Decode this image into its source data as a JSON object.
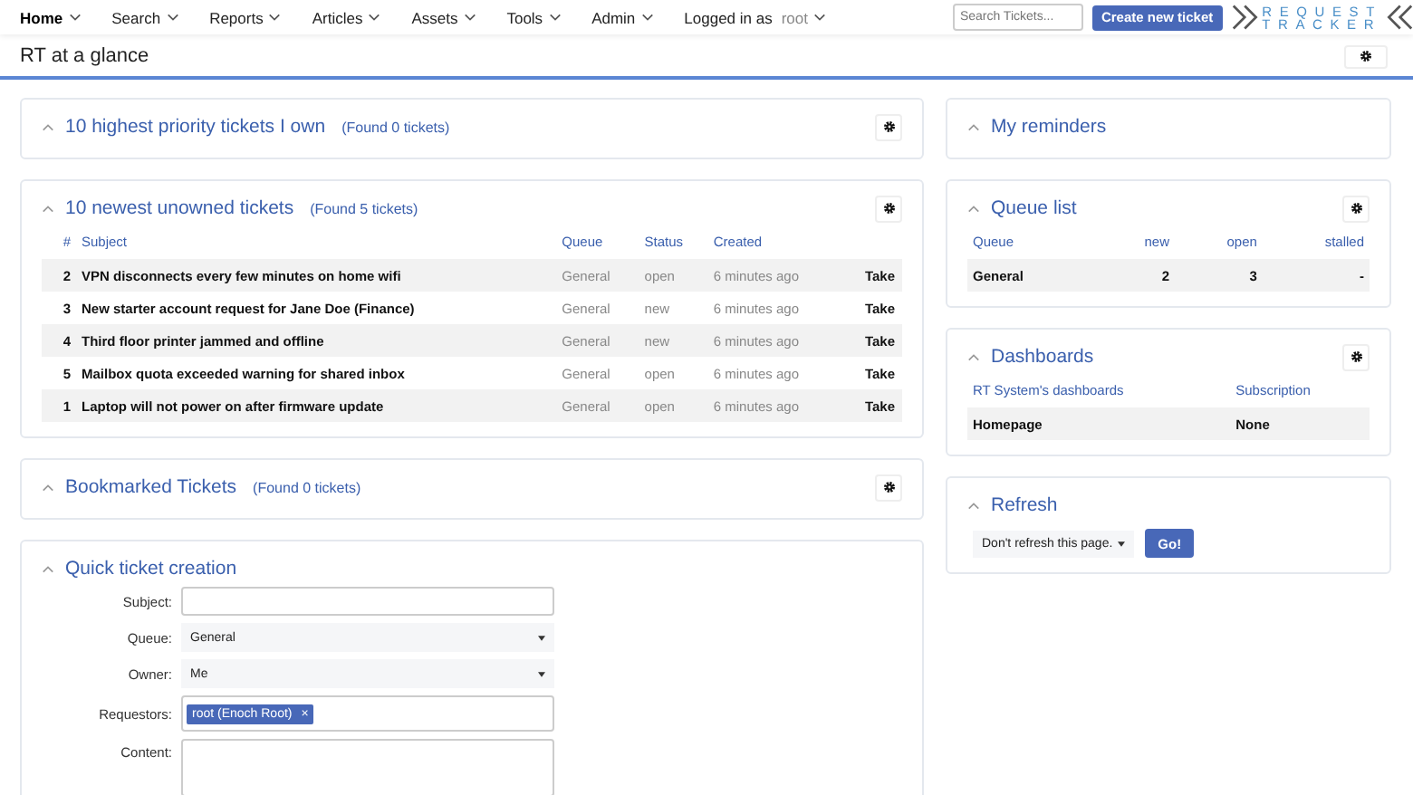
{
  "menu": [
    {
      "label": "Home",
      "selected": true
    },
    {
      "label": "Search",
      "selected": false
    },
    {
      "label": "Reports",
      "selected": false
    },
    {
      "label": "Articles",
      "selected": false
    },
    {
      "label": "Assets",
      "selected": false
    },
    {
      "label": "Tools",
      "selected": false
    },
    {
      "label": "Admin",
      "selected": false
    }
  ],
  "user_menu": {
    "label": "Logged in as",
    "user": "root"
  },
  "search": {
    "placeholder": "Search Tickets..."
  },
  "create_button": "Create new ticket",
  "logo": {
    "line_1": "REQUEST",
    "line_2": "TRACKER"
  },
  "page_title": "RT at a glance",
  "left_panels": [
    {
      "kind": "empty",
      "title": "10 highest priority tickets I own",
      "count": "(Found 0 tickets)",
      "settings": true
    },
    {
      "kind": "tickets",
      "title": "10 newest unowned tickets",
      "count": "(Found 5 tickets)",
      "settings": true,
      "columns": [
        "#",
        "Subject",
        "Queue",
        "Status",
        "Created"
      ],
      "rows": [
        {
          "id": "2",
          "subject": "VPN disconnects every few minutes on home wifi",
          "queue": "General",
          "status": "open",
          "created": "6 minutes ago",
          "action": "Take"
        },
        {
          "id": "3",
          "subject": "New starter account request for Jane Doe (Finance)",
          "queue": "General",
          "status": "new",
          "created": "6 minutes ago",
          "action": "Take"
        },
        {
          "id": "4",
          "subject": "Third floor printer jammed and offline",
          "queue": "General",
          "status": "new",
          "created": "6 minutes ago",
          "action": "Take"
        },
        {
          "id": "5",
          "subject": "Mailbox quota exceeded warning for shared inbox",
          "queue": "General",
          "status": "open",
          "created": "6 minutes ago",
          "action": "Take"
        },
        {
          "id": "1",
          "subject": "Laptop will not power on after firmware update",
          "queue": "General",
          "status": "open",
          "created": "6 minutes ago",
          "action": "Take"
        }
      ]
    },
    {
      "kind": "empty",
      "title": "Bookmarked Tickets",
      "count": "(Found 0 tickets)",
      "settings": true
    },
    {
      "kind": "form",
      "title": "Quick ticket creation",
      "settings": false,
      "fields": [
        {
          "kind": "text",
          "label": "Subject:"
        },
        {
          "kind": "select",
          "label": "Queue:",
          "value": "General"
        },
        {
          "kind": "select",
          "label": "Owner:",
          "value": "Me"
        },
        {
          "kind": "tags",
          "label": "Requestors:",
          "tags": [
            "root (Enoch Root)"
          ],
          "remove": "×"
        },
        {
          "kind": "textarea",
          "label": "Content:"
        }
      ]
    }
  ],
  "right_panels": [
    {
      "kind": "empty",
      "title": "My reminders",
      "settings": false
    },
    {
      "kind": "queues",
      "title": "Queue list",
      "settings": true,
      "columns": [
        "Queue",
        "new",
        "open",
        "stalled"
      ],
      "rows": [
        [
          "General",
          "2",
          "3",
          "-"
        ]
      ]
    },
    {
      "kind": "dashboards",
      "title": "Dashboards",
      "settings": true,
      "columns": [
        "RT System's dashboards",
        "Subscription"
      ],
      "rows": [
        [
          "Homepage",
          "None"
        ]
      ]
    },
    {
      "kind": "refresh",
      "title": "Refresh",
      "settings": false,
      "select": "Don't refresh this page.",
      "button": "Go!"
    }
  ]
}
